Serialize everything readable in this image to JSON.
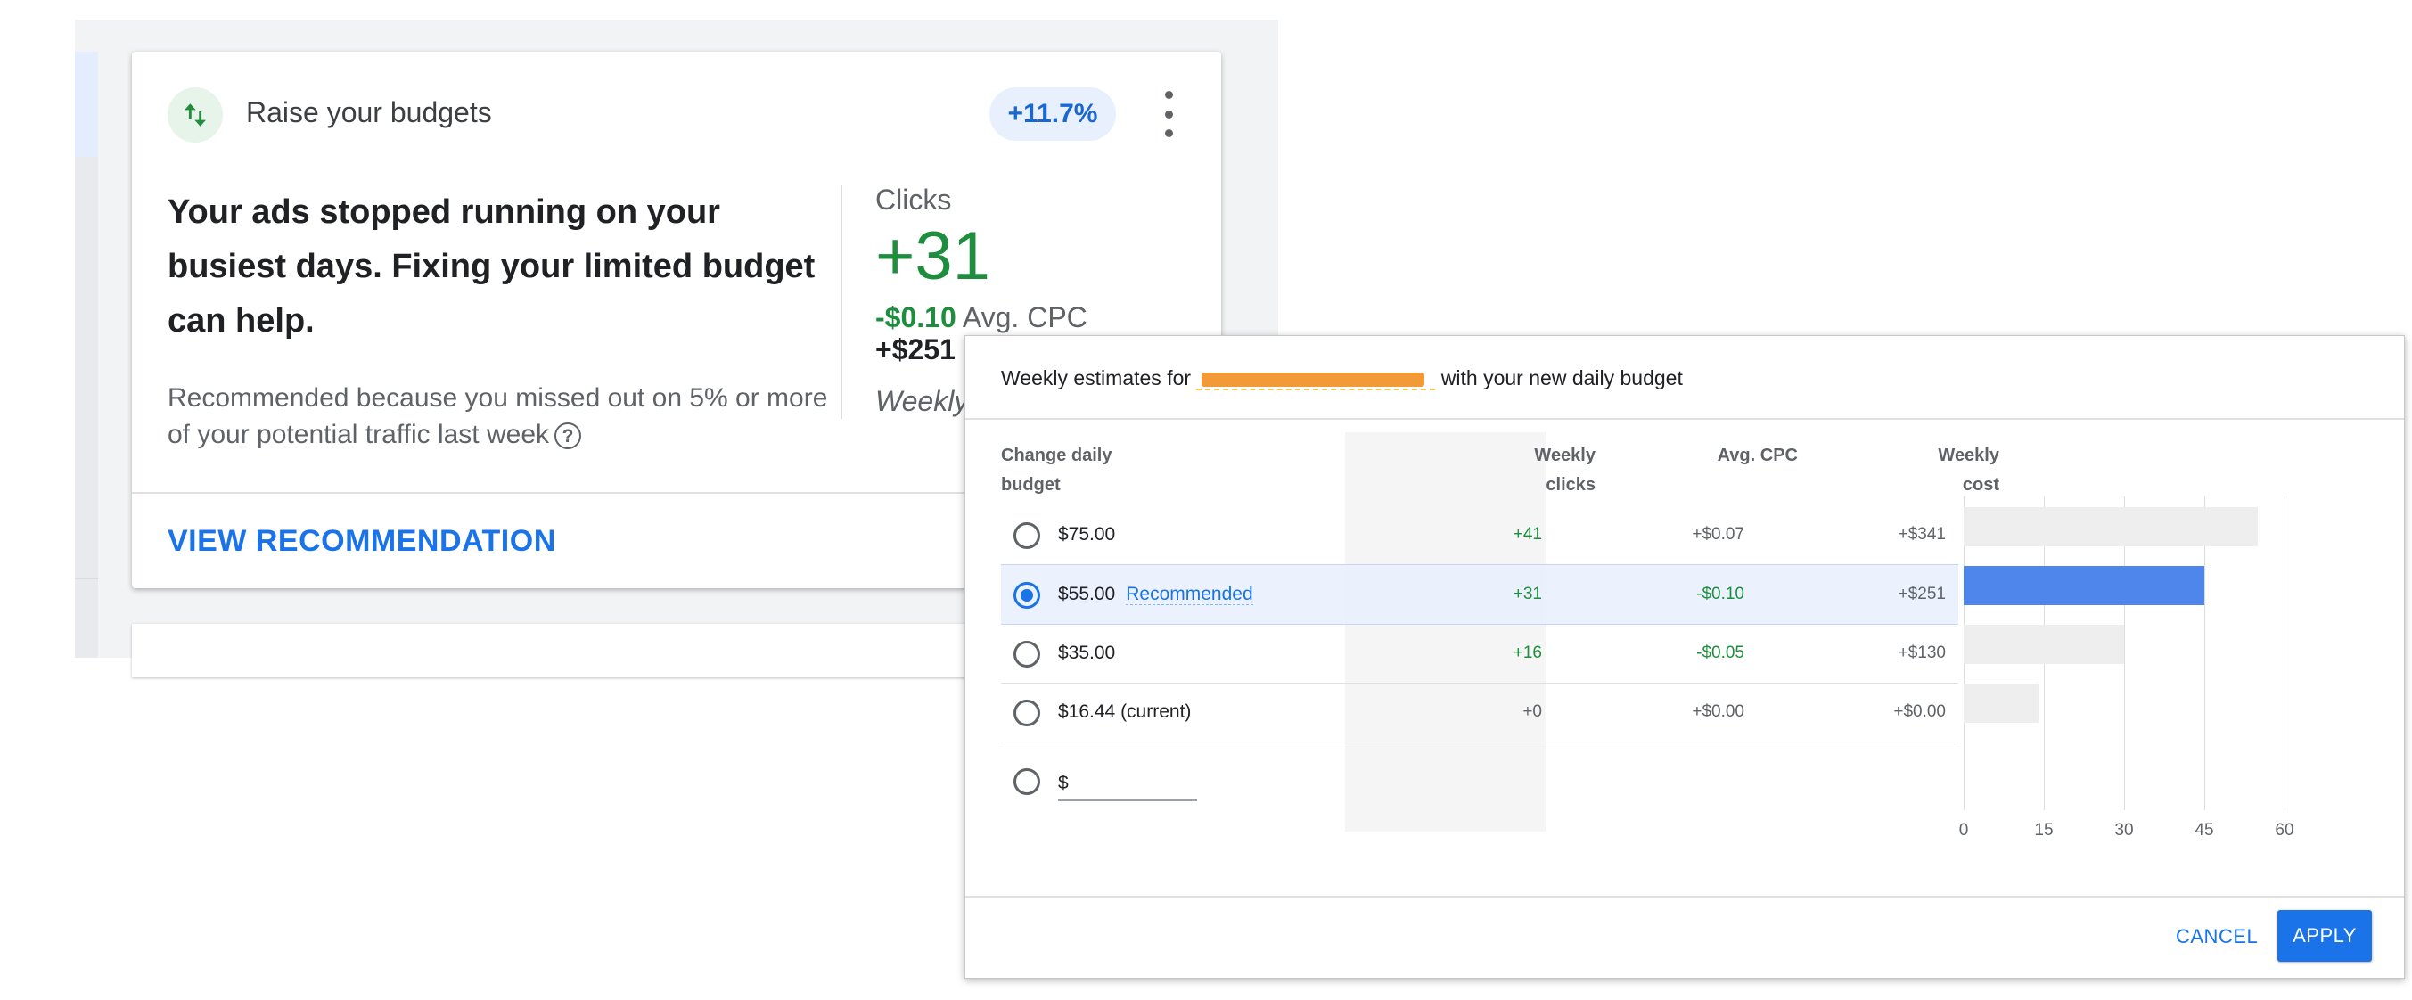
{
  "card": {
    "title": "Raise your budgets",
    "uplift_badge": "+11.7%",
    "headline": "Your ads stopped running on your busiest days. Fixing your limited budget can help.",
    "reason": "Recommended because you missed out on 5% or more of your potential traffic last week",
    "metric_label": "Clicks",
    "metric_value": "+31",
    "cpc_value": "-$0.10",
    "cpc_label": "Avg. CPC",
    "cost_value": "+$251",
    "weekly_partial": "Weekly",
    "action_label": "VIEW RECOMMENDATION",
    "icons": {
      "type": "swap-vert-icon",
      "more": "more-vert-icon",
      "help": "help-circle-icon"
    },
    "colors": {
      "positive": "#1e8e3e",
      "accent": "#1a73e8",
      "badge_bg": "#e8f0fe"
    }
  },
  "popup": {
    "title_prefix": "Weekly estimates for ",
    "title_suffix": " with your new daily budget",
    "headers": {
      "budget_line1": "Change daily",
      "budget_line2": "budget",
      "clicks_line1": "Weekly",
      "clicks_line2": "clicks",
      "cpc": "Avg. CPC",
      "cost_line1": "Weekly",
      "cost_line2": "cost"
    },
    "rows": [
      {
        "budget": "$75.00",
        "tag": "",
        "clicks": "+41",
        "cpc": "+$0.07",
        "cost": "+$341"
      },
      {
        "budget": "$55.00",
        "tag": "Recommended",
        "clicks": "+31",
        "cpc": "-$0.10",
        "cost": "+$251"
      },
      {
        "budget": "$35.00",
        "tag": "",
        "clicks": "+16",
        "cpc": "-$0.05",
        "cost": "+$130"
      },
      {
        "budget": "$16.44 (current)",
        "tag": "",
        "clicks": "+0",
        "cpc": "+$0.00",
        "cost": "+$0.00"
      }
    ],
    "custom_prefix": "$",
    "custom_value": "",
    "selected_row": 1,
    "cancel_label": "CANCEL",
    "apply_label": "APPLY"
  },
  "chart_data": {
    "type": "bar",
    "orientation": "horizontal",
    "categories": [
      "$75.00",
      "$55.00",
      "$35.00",
      "$16.44 (current)"
    ],
    "values": [
      55,
      45,
      30,
      14
    ],
    "highlight_index": 1,
    "xticks": [
      "0",
      "15",
      "30",
      "45",
      "60"
    ],
    "xlim": [
      0,
      60
    ],
    "grid": true,
    "colors": {
      "default": "#eeeeee",
      "highlight": "#4f86ec"
    }
  }
}
